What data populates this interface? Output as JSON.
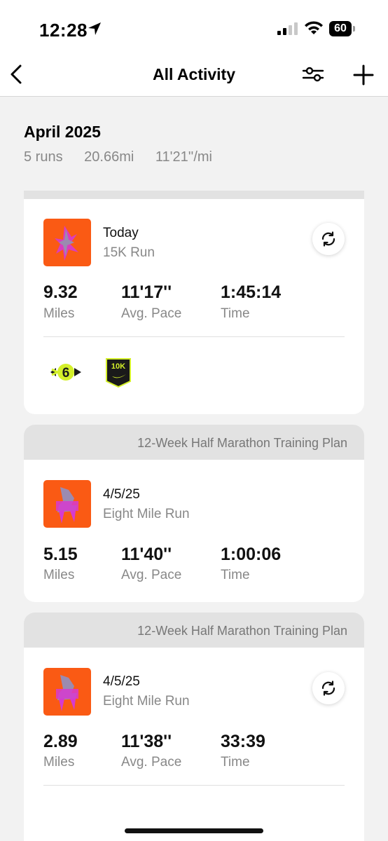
{
  "status": {
    "time": "12:28",
    "battery": "60"
  },
  "nav": {
    "title": "All Activity"
  },
  "month": {
    "title": "April 2025",
    "runs": "5 runs",
    "distance": "20.66mi",
    "pace": "11'21''/mi"
  },
  "activities": [
    {
      "plan": "",
      "date": "Today",
      "name": "15K Run",
      "distance": "9.32",
      "distance_label": "Miles",
      "pace": "11'17''",
      "pace_label": "Avg. Pace",
      "time": "1:45:14",
      "time_label": "Time",
      "badges": [
        "streak-6-badge",
        "10k-badge"
      ],
      "badge_10k_text": "10K"
    },
    {
      "plan": "12-Week Half Marathon Training Plan",
      "date": "4/5/25",
      "name": "Eight Mile Run",
      "distance": "5.15",
      "distance_label": "Miles",
      "pace": "11'40''",
      "pace_label": "Avg. Pace",
      "time": "1:00:06",
      "time_label": "Time"
    },
    {
      "plan": "12-Week Half Marathon Training Plan",
      "date": "4/5/25",
      "name": "Eight Mile Run",
      "distance": "2.89",
      "distance_label": "Miles",
      "pace": "11'38''",
      "pace_label": "Avg. Pace",
      "time": "33:39",
      "time_label": "Time"
    }
  ],
  "colors": {
    "accent": "#fa5a14",
    "badge": "#d4f02a",
    "thumbArt": "#d63ad0"
  }
}
